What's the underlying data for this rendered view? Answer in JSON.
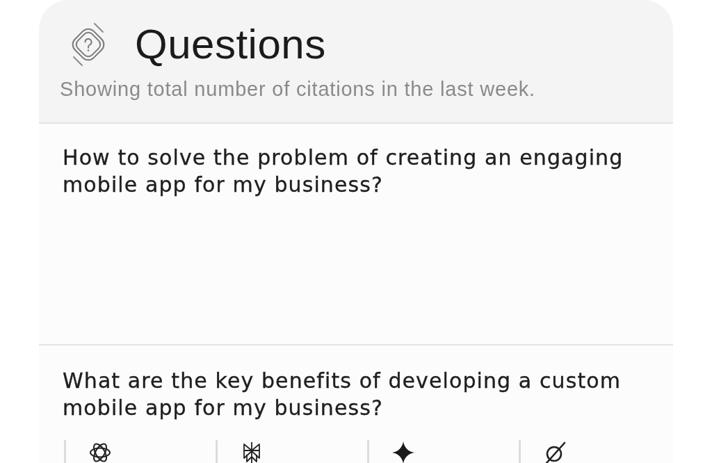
{
  "header": {
    "title": "Questions",
    "subtitle": "Showing total number of citations in the last week."
  },
  "questions": [
    {
      "text": "How to solve the problem of creating an engaging mobile app for my business?"
    },
    {
      "text": "What are the key benefits of developing a custom mobile app for my business?",
      "sources": [
        {
          "kind": "rings"
        },
        {
          "kind": "lattice"
        },
        {
          "kind": "sparkle"
        },
        {
          "kind": "slash"
        }
      ]
    }
  ]
}
